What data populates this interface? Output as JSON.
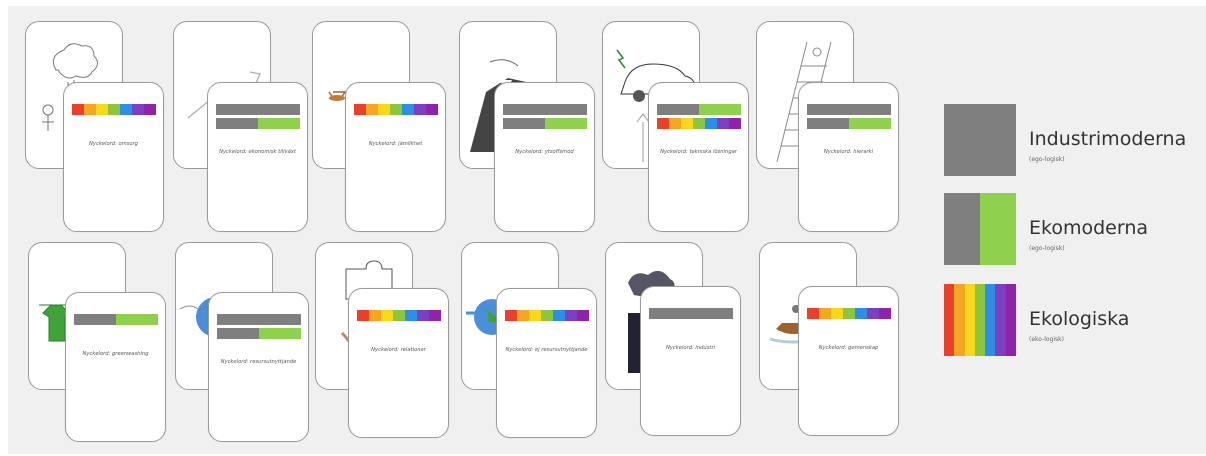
{
  "colors": {
    "gray": "#7f7f7f",
    "green": "#8fd14f",
    "rainbow": [
      "#e8402b",
      "#f5a623",
      "#f8d81c",
      "#8cc63f",
      "#2e8ee5",
      "#7c3fbf",
      "#8e24aa"
    ]
  },
  "cards": [
    {
      "keyword": "Nyckelord: omsorg",
      "bars": [
        "rainbow"
      ],
      "illustration": "tree-icon"
    },
    {
      "keyword": "Nyckelord: ekonomisk tillväxt",
      "bars": [
        "gray",
        "gray-green"
      ],
      "illustration": "rising-arrow-icon"
    },
    {
      "keyword": "Nyckelord: jämlikhet",
      "bars": [
        "rainbow"
      ],
      "illustration": "scales-icon"
    },
    {
      "keyword": "Nyckelord: ytsoffsmod",
      "bars": [
        "gray",
        "gray-green"
      ],
      "illustration": "businessman-icon"
    },
    {
      "keyword": "Nyckelord: tekniska lösningar",
      "bars": [
        "gray-green",
        "rainbow"
      ],
      "illustration": "electric-car-icon"
    },
    {
      "keyword": "Nyckelord: hierarki",
      "bars": [
        "gray",
        "gray-green"
      ],
      "illustration": "ladder-icon"
    },
    {
      "keyword": "Nyckelord: greenwashing",
      "bars": [
        "gray-green"
      ],
      "illustration": "green-shirt-icon"
    },
    {
      "keyword": "Nyckelord: resursutnyttjande",
      "bars": [
        "gray",
        "gray-green"
      ],
      "illustration": "globe-icon"
    },
    {
      "keyword": "Nyckelord: relationer",
      "bars": [
        "rainbow"
      ],
      "illustration": "puzzle-icon"
    },
    {
      "keyword": "Nyckelord: ej resursutnyttjande",
      "bars": [
        "rainbow"
      ],
      "illustration": "globe-hand-icon"
    },
    {
      "keyword": "Nyckelord: industri",
      "bars": [
        "gray"
      ],
      "illustration": "factory-smoke-icon"
    },
    {
      "keyword": "Nyckelord: gemenskap",
      "bars": [
        "rainbow"
      ],
      "illustration": "boat-icon"
    }
  ],
  "legend": [
    {
      "title": "Industrimoderna",
      "subtitle": "(ego-logisk)",
      "swatch": "gray"
    },
    {
      "title": "Ekomoderna",
      "subtitle": "(ego-logisk)",
      "swatch": "gray-green"
    },
    {
      "title": "Ekologiska",
      "subtitle": "(eko-logisk)",
      "swatch": "rainbow"
    }
  ]
}
